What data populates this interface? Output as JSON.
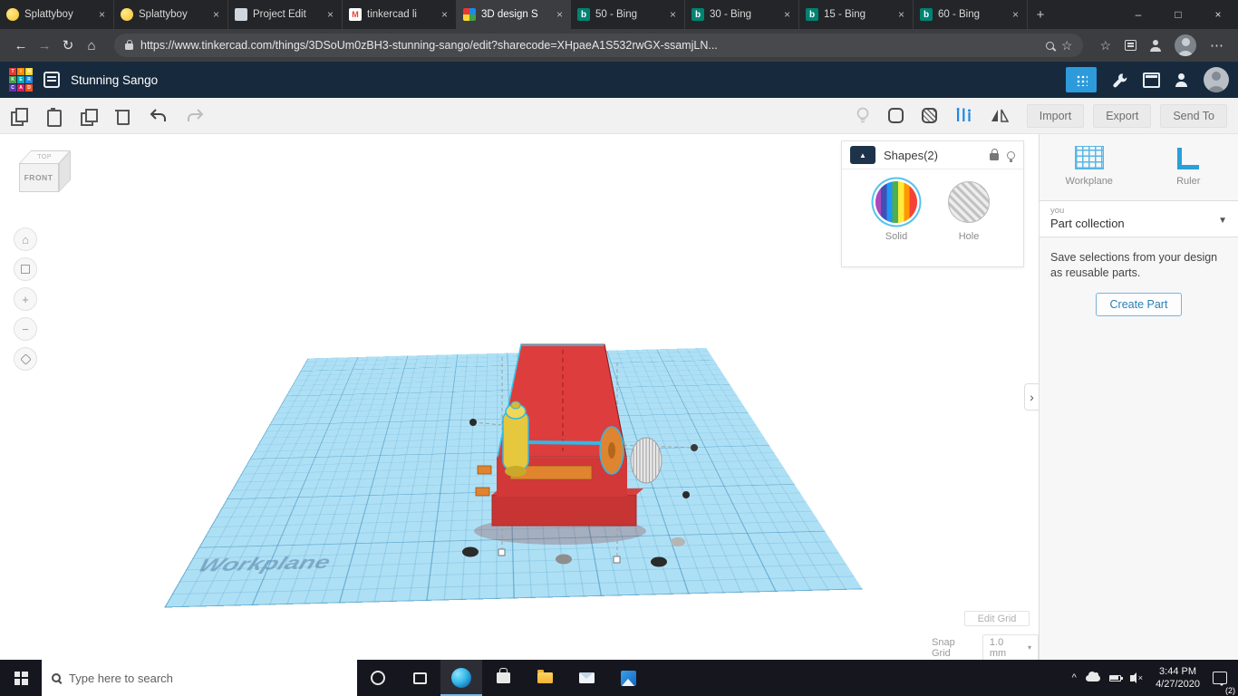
{
  "icons": {
    "close": "×",
    "new_tab": "+",
    "minimize": "–",
    "maximize": "□",
    "back": "←",
    "forward": "→",
    "refresh": "↻",
    "home": "⌂",
    "star": "☆",
    "menu": "⋯",
    "gmail": "M",
    "bing": "b",
    "caret_small": "▾",
    "caret_down": "▼",
    "collapse": "▲",
    "chevron": "›",
    "tray_up": "^",
    "mute": "×",
    "zoom_in": "+",
    "zoom_out": "−"
  },
  "browser": {
    "tabs": [
      {
        "label": "Splattyboy"
      },
      {
        "label": "Splattyboy"
      },
      {
        "label": "Project Edit"
      },
      {
        "label": "tinkercad li"
      },
      {
        "label": "3D design S"
      },
      {
        "label": "50 - Bing"
      },
      {
        "label": "30 - Bing"
      },
      {
        "label": "15 - Bing"
      },
      {
        "label": "60 - Bing"
      }
    ],
    "url": "https://www.tinkercad.com/things/3DSoUm0zBH3-stunning-sango/edit?sharecode=XHpaeA1S532rwGX-ssamjLN..."
  },
  "header": {
    "logo_letters": [
      "T",
      "I",
      "N",
      "K",
      "E",
      "R",
      "C",
      "A",
      "D"
    ],
    "title": "Stunning Sango"
  },
  "toolbar": {
    "import_label": "Import",
    "export_label": "Export",
    "send_to_label": "Send To"
  },
  "shapes_panel": {
    "title": "Shapes(2)",
    "solid_label": "Solid",
    "hole_label": "Hole"
  },
  "viewcube": {
    "top": "TOP",
    "front": "FRONT"
  },
  "canvas": {
    "workplane_label": "Workplane",
    "edit_grid_label": "Edit Grid",
    "snap_grid_label": "Snap Grid",
    "snap_grid_value": "1.0 mm"
  },
  "sidebar": {
    "workplane_label": "Workplane",
    "ruler_label": "Ruler",
    "collection_owner": "you",
    "collection_name": "Part collection",
    "description": "Save selections from your design as reusable parts.",
    "create_part_label": "Create Part"
  },
  "taskbar": {
    "search_placeholder": "Type here to search",
    "time": "3:44 PM",
    "date": "4/27/2020",
    "notification_badge": "(2)"
  },
  "colors": {
    "accent_blue": "#2a9fd8",
    "selection_cyan": "#35c6f0",
    "model_red": "#de3d3d",
    "workplane_blue": "#aee0f5"
  }
}
